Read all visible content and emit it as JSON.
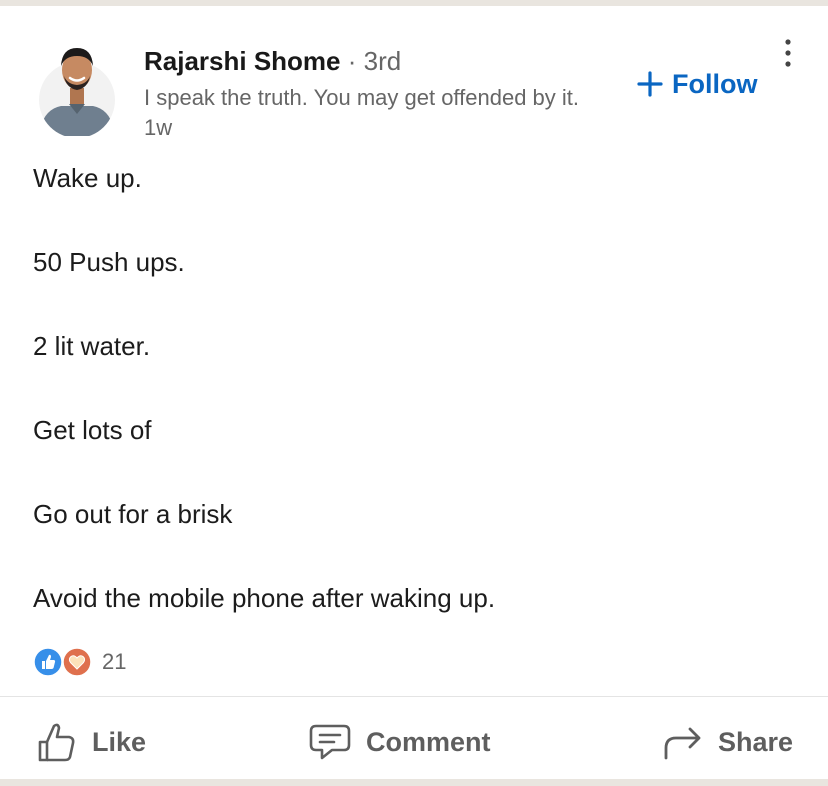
{
  "post": {
    "author": {
      "name": "Rajarshi Shome",
      "degree": "· 3rd",
      "headline": "I speak the truth. You may get offended by it.",
      "timestamp": "1w"
    },
    "follow_label": "Follow",
    "body_lines": [
      "Wake up.",
      "50 Push ups.",
      "2 lit water.",
      "Get lots of",
      "Go out for a brisk",
      "Avoid the mobile phone after waking up."
    ],
    "reactions": {
      "types": [
        "like",
        "love"
      ],
      "count": "21"
    }
  },
  "actions": {
    "like_label": "Like",
    "comment_label": "Comment",
    "share_label": "Share"
  },
  "colors": {
    "accent": "#0a66c2",
    "like_badge": "#378fe9",
    "love_badge": "#df704d",
    "muted_text": "#666666",
    "action_text": "#5e5e5e"
  },
  "icons": {
    "follow": "plus-icon",
    "menu": "more-vertical-icon",
    "like": "thumbs-up-icon",
    "comment": "comment-icon",
    "share": "share-arrow-icon"
  }
}
